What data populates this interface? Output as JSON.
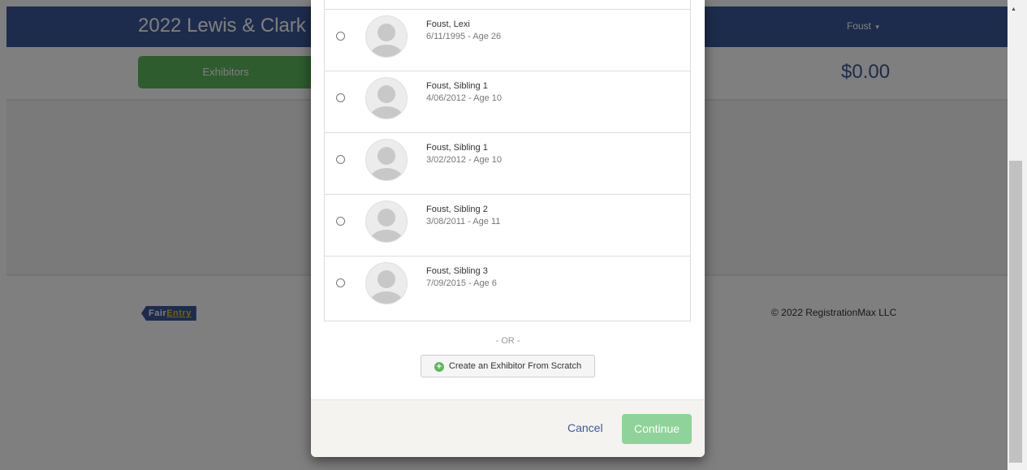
{
  "nav": {
    "title": "2022 Lewis & Clark",
    "user": "Foust",
    "user_caret": "▾"
  },
  "subbar": {
    "exhibitors_label": "Exhibitors",
    "total": "$0.00"
  },
  "footer": {
    "logo_fair": "Fair",
    "logo_entry": "Entry",
    "copyright": "© 2022 RegistrationMax LLC"
  },
  "modal": {
    "exhibitors": [
      {
        "name": "Foust, Lexi",
        "dob": "6/11/1995 - Age 26"
      },
      {
        "name": "Foust, Sibling 1",
        "dob": "4/06/2012 - Age 10"
      },
      {
        "name": "Foust, Sibling 1",
        "dob": "3/02/2012 - Age 10"
      },
      {
        "name": "Foust, Sibling 2",
        "dob": "3/08/2011 - Age 11"
      },
      {
        "name": "Foust, Sibling 3",
        "dob": "7/09/2015 - Age 6"
      }
    ],
    "or_text": "- OR -",
    "create_button": "Create an Exhibitor From Scratch",
    "cancel_label": "Cancel",
    "continue_label": "Continue"
  },
  "colors": {
    "brand": "#3b5998",
    "success": "#5cb85c",
    "continue_disabled": "#8fd39a"
  }
}
